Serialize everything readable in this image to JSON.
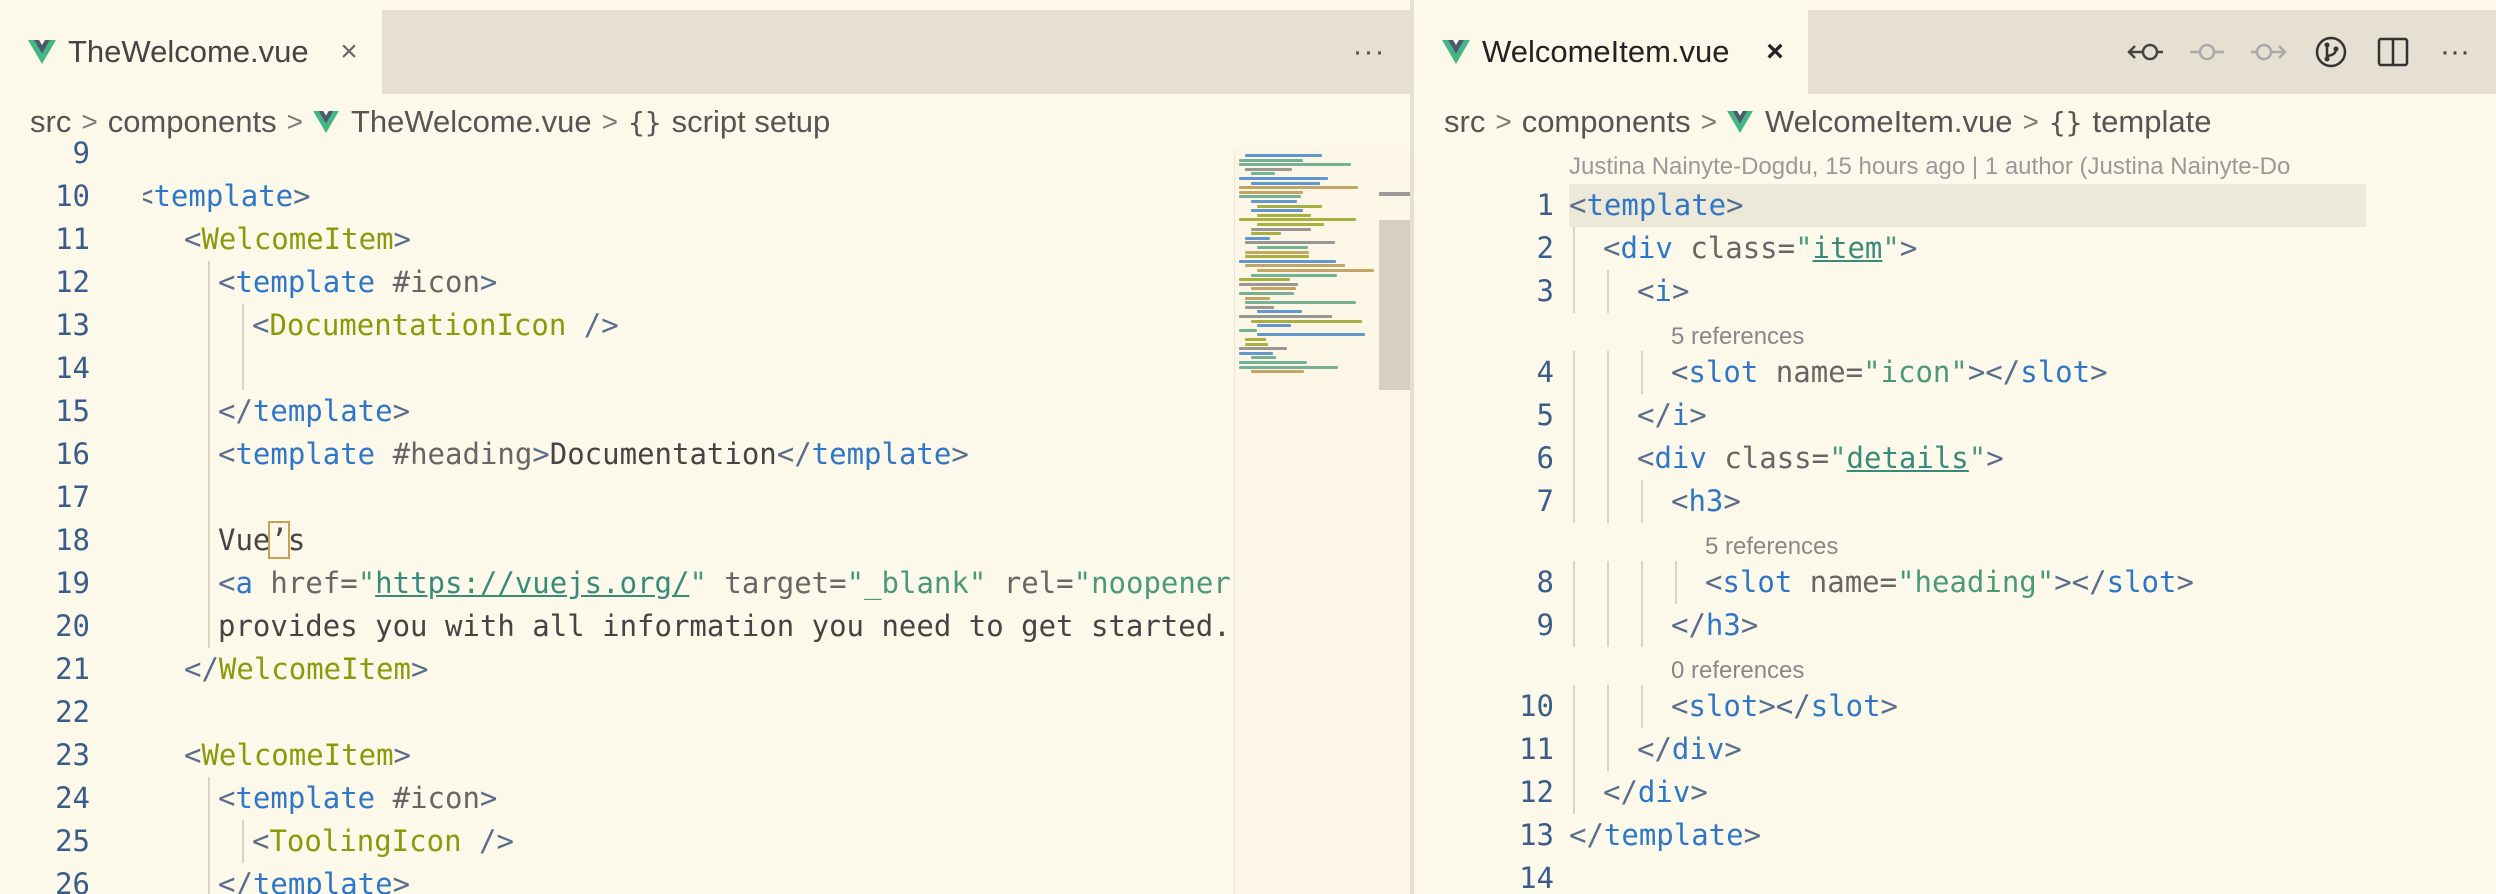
{
  "left_editor": {
    "tab": {
      "title": "TheWelcome.vue",
      "close": "×"
    },
    "more_actions": "···",
    "breadcrumb": [
      "src",
      "components",
      "TheWelcome.vue",
      "script setup"
    ],
    "breadcrumb_separator": ">",
    "breadcrumb_braces": "{}",
    "lines": [
      {
        "n": "9",
        "indent": 0,
        "tokens": []
      },
      {
        "n": "10",
        "indent": 0,
        "tokens": [
          {
            "t": "<",
            "k": "punct",
            "partial": true
          },
          {
            "t": "template",
            "k": "tag"
          },
          {
            "t": ">",
            "k": "punct"
          }
        ]
      },
      {
        "n": "11",
        "indent": 1,
        "tokens": [
          {
            "t": "<",
            "k": "punct"
          },
          {
            "t": "WelcomeItem",
            "k": "comp"
          },
          {
            "t": ">",
            "k": "punct"
          }
        ]
      },
      {
        "n": "12",
        "indent": 2,
        "tokens": [
          {
            "t": "<",
            "k": "punct"
          },
          {
            "t": "template",
            "k": "tag"
          },
          {
            "t": " #icon",
            "k": "attr"
          },
          {
            "t": ">",
            "k": "punct"
          }
        ]
      },
      {
        "n": "13",
        "indent": 3,
        "tokens": [
          {
            "t": "<",
            "k": "punct"
          },
          {
            "t": "DocumentationIcon",
            "k": "comp"
          },
          {
            "t": " />",
            "k": "punct"
          }
        ]
      },
      {
        "n": "14",
        "indent": 3,
        "tokens": []
      },
      {
        "n": "15",
        "indent": 2,
        "tokens": [
          {
            "t": "</",
            "k": "punct"
          },
          {
            "t": "template",
            "k": "tag"
          },
          {
            "t": ">",
            "k": "punct"
          }
        ]
      },
      {
        "n": "16",
        "indent": 2,
        "tokens": [
          {
            "t": "<",
            "k": "punct"
          },
          {
            "t": "template",
            "k": "tag"
          },
          {
            "t": " #heading",
            "k": "attr"
          },
          {
            "t": ">",
            "k": "punct"
          },
          {
            "t": "Documentation",
            "k": "text"
          },
          {
            "t": "</",
            "k": "punct"
          },
          {
            "t": "template",
            "k": "tag"
          },
          {
            "t": ">",
            "k": "punct"
          }
        ]
      },
      {
        "n": "17",
        "indent": 2,
        "tokens": []
      },
      {
        "n": "18",
        "indent": 2,
        "tokens": [
          {
            "t": "Vue",
            "k": "text"
          },
          {
            "t": "’",
            "k": "mark"
          },
          {
            "t": "s",
            "k": "text"
          }
        ]
      },
      {
        "n": "19",
        "indent": 2,
        "tokens": [
          {
            "t": "<",
            "k": "punct"
          },
          {
            "t": "a",
            "k": "tag"
          },
          {
            "t": " href=",
            "k": "attr"
          },
          {
            "t": "\"",
            "k": "str"
          },
          {
            "t": "https://vuejs.org/",
            "k": "link"
          },
          {
            "t": "\"",
            "k": "str"
          },
          {
            "t": " target=",
            "k": "attr"
          },
          {
            "t": "\"_blank\"",
            "k": "str"
          },
          {
            "t": " rel=",
            "k": "attr"
          },
          {
            "t": "\"noopener\"",
            "k": "str"
          },
          {
            "t": ">",
            "k": "punct"
          }
        ]
      },
      {
        "n": "20",
        "indent": 2,
        "tokens": [
          {
            "t": "provides you with all information you need to get started.",
            "k": "text"
          }
        ]
      },
      {
        "n": "21",
        "indent": 1,
        "tokens": [
          {
            "t": "</",
            "k": "punct"
          },
          {
            "t": "WelcomeItem",
            "k": "comp"
          },
          {
            "t": ">",
            "k": "punct"
          }
        ]
      },
      {
        "n": "22",
        "indent": 0,
        "tokens": []
      },
      {
        "n": "23",
        "indent": 1,
        "tokens": [
          {
            "t": "<",
            "k": "punct"
          },
          {
            "t": "WelcomeItem",
            "k": "comp"
          },
          {
            "t": ">",
            "k": "punct"
          }
        ]
      },
      {
        "n": "24",
        "indent": 2,
        "tokens": [
          {
            "t": "<",
            "k": "punct"
          },
          {
            "t": "template",
            "k": "tag"
          },
          {
            "t": " #icon",
            "k": "attr"
          },
          {
            "t": ">",
            "k": "punct"
          }
        ]
      },
      {
        "n": "25",
        "indent": 3,
        "tokens": [
          {
            "t": "<",
            "k": "punct"
          },
          {
            "t": "ToolingIcon",
            "k": "comp"
          },
          {
            "t": " />",
            "k": "punct"
          }
        ]
      },
      {
        "n": "26",
        "indent": 2,
        "tokens": [
          {
            "t": "</",
            "k": "punct"
          },
          {
            "t": "template",
            "k": "tag"
          },
          {
            "t": ">",
            "k": "punct"
          }
        ]
      }
    ]
  },
  "right_editor": {
    "tab": {
      "title": "WelcomeItem.vue",
      "close": "×"
    },
    "actions": [
      "go-back-icon",
      "commit-icon",
      "go-forward-icon",
      "git-history-icon",
      "split-editor-icon",
      "more-actions-icon"
    ],
    "more_actions": "···",
    "breadcrumb": [
      "src",
      "components",
      "WelcomeItem.vue",
      "template"
    ],
    "breadcrumb_separator": ">",
    "breadcrumb_braces": "{}",
    "blame": "Justina Nainyte-Dogdu, 15 hours ago | 1 author (Justina Nainyte-Do",
    "lines": [
      {
        "n": "1",
        "indent": 0,
        "current": true,
        "tokens": [
          {
            "t": "<",
            "k": "punct"
          },
          {
            "t": "template",
            "k": "tag"
          },
          {
            "t": ">",
            "k": "punct"
          }
        ]
      },
      {
        "n": "2",
        "indent": 1,
        "tokens": [
          {
            "t": "<",
            "k": "punct"
          },
          {
            "t": "div",
            "k": "tag"
          },
          {
            "t": " class=",
            "k": "attr"
          },
          {
            "t": "\"",
            "k": "str"
          },
          {
            "t": "item",
            "k": "link"
          },
          {
            "t": "\"",
            "k": "str"
          },
          {
            "t": ">",
            "k": "punct"
          }
        ]
      },
      {
        "n": "3",
        "indent": 2,
        "tokens": [
          {
            "t": "<",
            "k": "punct"
          },
          {
            "t": "i",
            "k": "tag"
          },
          {
            "t": ">",
            "k": "punct"
          }
        ]
      },
      {
        "n": "4",
        "indent": 3,
        "lens": "5 references",
        "tokens": [
          {
            "t": "<",
            "k": "punct"
          },
          {
            "t": "slot",
            "k": "tag"
          },
          {
            "t": " name=",
            "k": "attr"
          },
          {
            "t": "\"icon\"",
            "k": "str"
          },
          {
            "t": "></",
            "k": "punct"
          },
          {
            "t": "slot",
            "k": "tag"
          },
          {
            "t": ">",
            "k": "punct"
          }
        ]
      },
      {
        "n": "5",
        "indent": 2,
        "tokens": [
          {
            "t": "</",
            "k": "punct"
          },
          {
            "t": "i",
            "k": "tag"
          },
          {
            "t": ">",
            "k": "punct"
          }
        ]
      },
      {
        "n": "6",
        "indent": 2,
        "tokens": [
          {
            "t": "<",
            "k": "punct"
          },
          {
            "t": "div",
            "k": "tag"
          },
          {
            "t": " class=",
            "k": "attr"
          },
          {
            "t": "\"",
            "k": "str"
          },
          {
            "t": "details",
            "k": "link"
          },
          {
            "t": "\"",
            "k": "str"
          },
          {
            "t": ">",
            "k": "punct"
          }
        ]
      },
      {
        "n": "7",
        "indent": 3,
        "tokens": [
          {
            "t": "<",
            "k": "punct"
          },
          {
            "t": "h3",
            "k": "tag"
          },
          {
            "t": ">",
            "k": "punct"
          }
        ]
      },
      {
        "n": "8",
        "indent": 4,
        "lens": "5 references",
        "tokens": [
          {
            "t": "<",
            "k": "punct"
          },
          {
            "t": "slot",
            "k": "tag"
          },
          {
            "t": " name=",
            "k": "attr"
          },
          {
            "t": "\"heading\"",
            "k": "str"
          },
          {
            "t": "></",
            "k": "punct"
          },
          {
            "t": "slot",
            "k": "tag"
          },
          {
            "t": ">",
            "k": "punct"
          }
        ]
      },
      {
        "n": "9",
        "indent": 3,
        "tokens": [
          {
            "t": "</",
            "k": "punct"
          },
          {
            "t": "h3",
            "k": "tag"
          },
          {
            "t": ">",
            "k": "punct"
          }
        ]
      },
      {
        "n": "10",
        "indent": 3,
        "lens": "0 references",
        "tokens": [
          {
            "t": "<",
            "k": "punct"
          },
          {
            "t": "slot",
            "k": "tag"
          },
          {
            "t": "></",
            "k": "punct"
          },
          {
            "t": "slot",
            "k": "tag"
          },
          {
            "t": ">",
            "k": "punct"
          }
        ]
      },
      {
        "n": "11",
        "indent": 2,
        "tokens": [
          {
            "t": "</",
            "k": "punct"
          },
          {
            "t": "div",
            "k": "tag"
          },
          {
            "t": ">",
            "k": "punct"
          }
        ]
      },
      {
        "n": "12",
        "indent": 1,
        "tokens": [
          {
            "t": "</",
            "k": "punct"
          },
          {
            "t": "div",
            "k": "tag"
          },
          {
            "t": ">",
            "k": "punct"
          }
        ]
      },
      {
        "n": "13",
        "indent": 0,
        "tokens": [
          {
            "t": "</",
            "k": "punct"
          },
          {
            "t": "template",
            "k": "tag"
          },
          {
            "t": ">",
            "k": "punct"
          }
        ]
      },
      {
        "n": "14",
        "indent": 0,
        "tokens": []
      }
    ]
  },
  "colors": {
    "editor_bg": "#fdf9ea",
    "tabbar_bg": "#e5e0d2",
    "tag": "#2f77c6",
    "component": "#8a9a0b",
    "string": "#4a9a7a",
    "line_number": "#3a5c89",
    "vue_green": "#41b883",
    "vue_dark": "#35495e"
  }
}
